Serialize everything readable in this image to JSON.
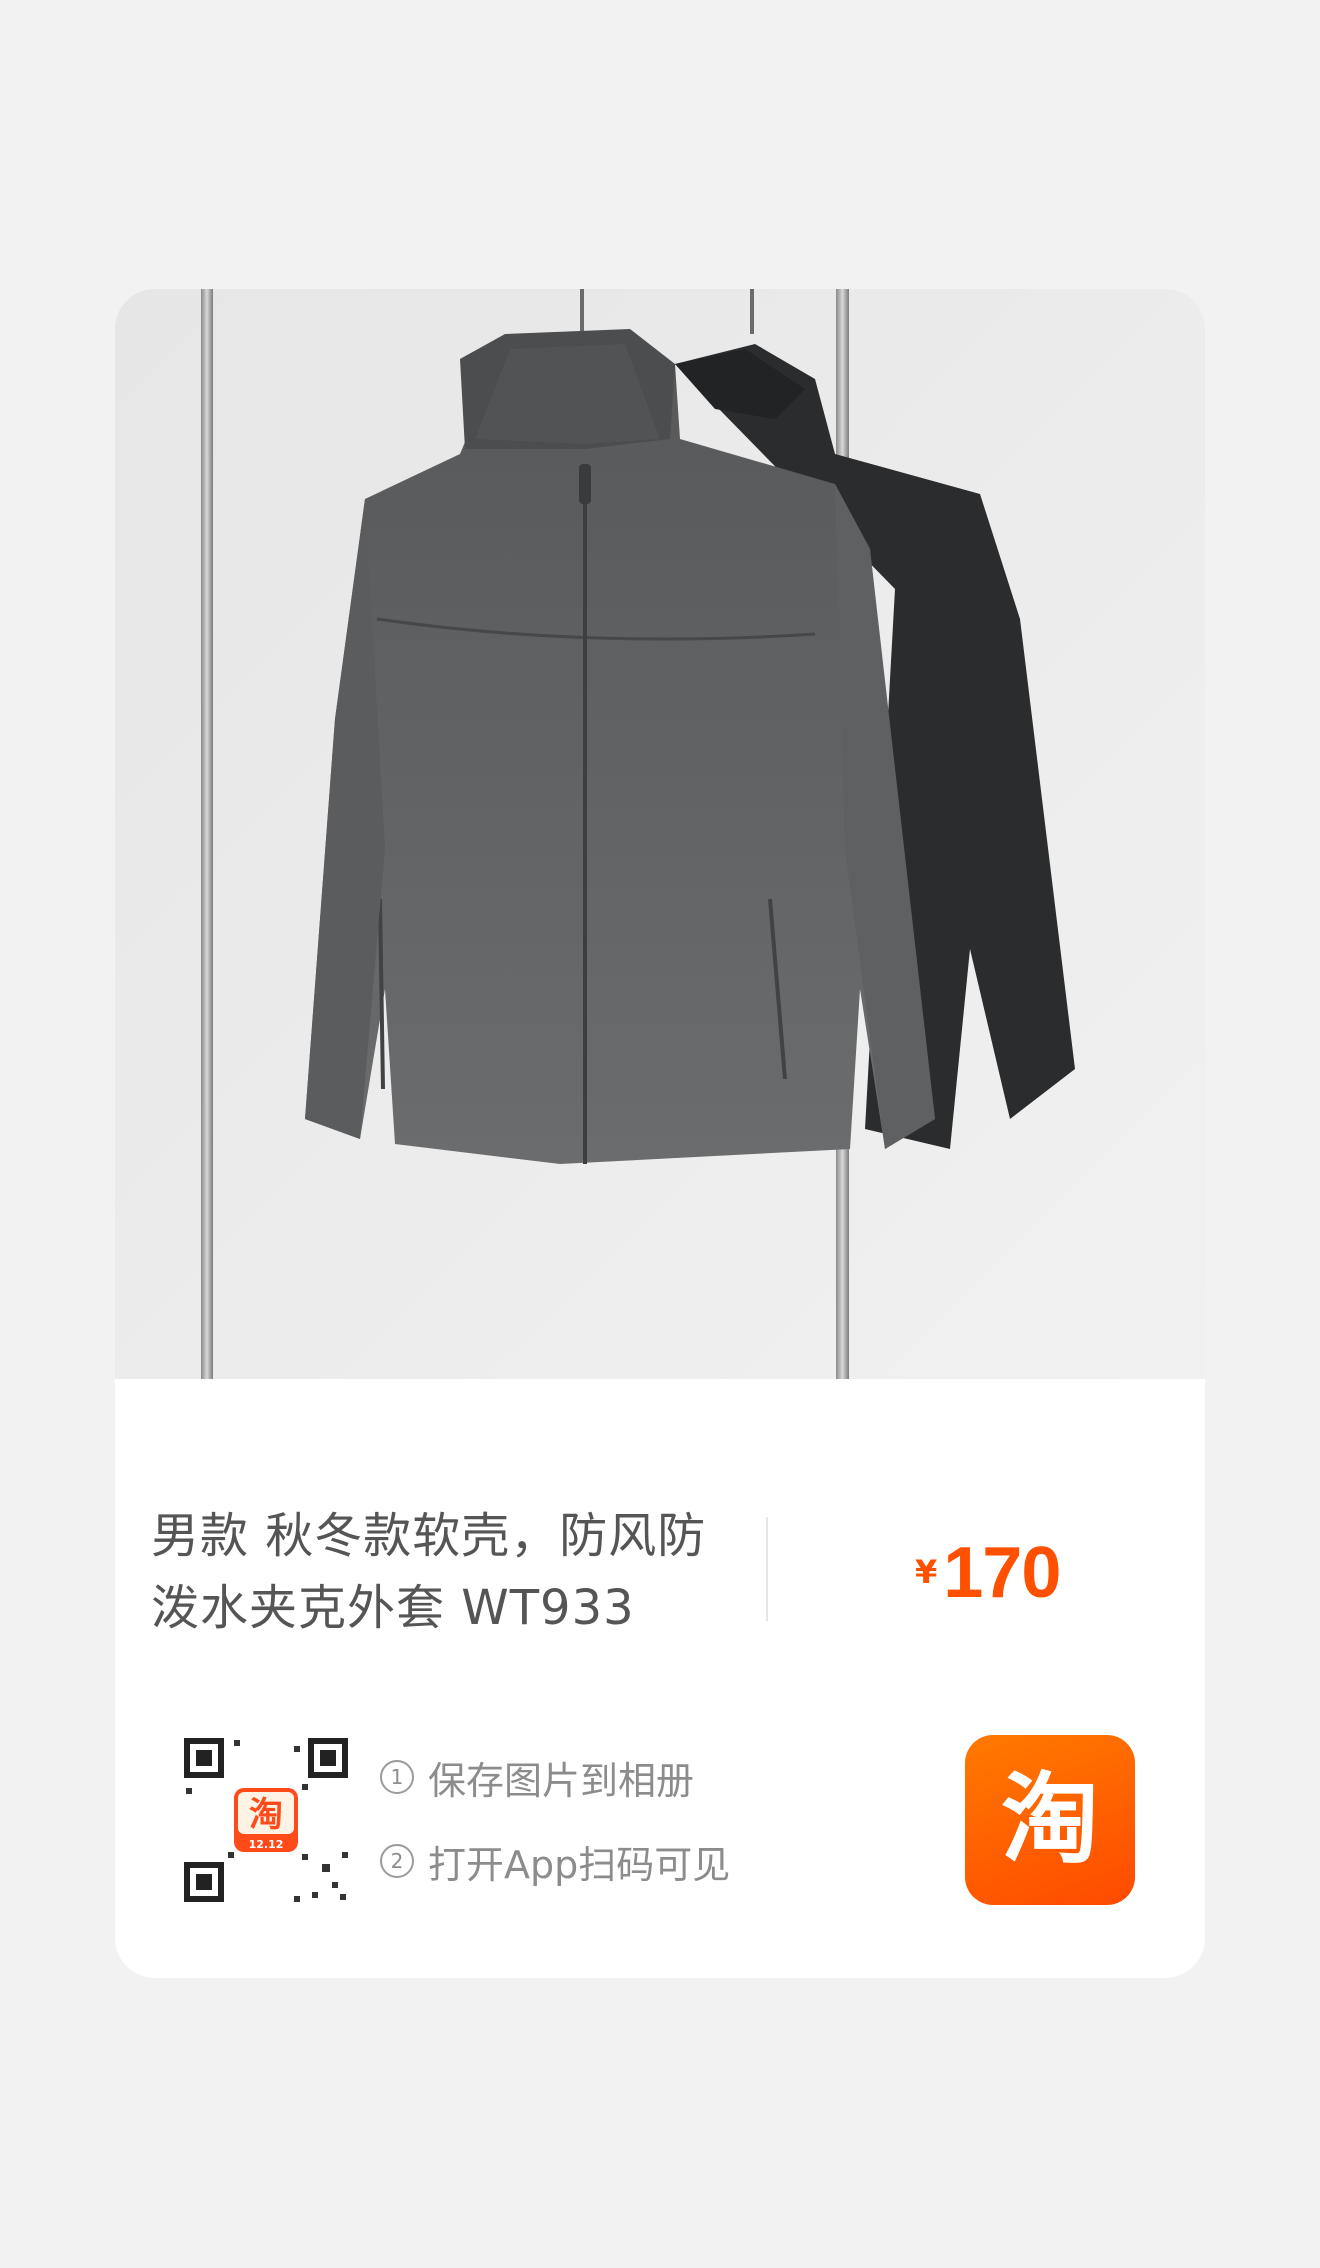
{
  "product": {
    "title": "男款 秋冬款软壳，防风防泼水夹克外套 WT933",
    "price_currency": "¥",
    "price_value": "170",
    "image_alt": "two zip-up jackets hanging on a clothing rack"
  },
  "share": {
    "steps": [
      {
        "number": "1",
        "text": "保存图片到相册"
      },
      {
        "number": "2",
        "text": "打开App扫码可见"
      }
    ],
    "qr_badge_text": "12.12"
  },
  "colors": {
    "accent": "#ff5000",
    "logo_top": "#ff7a00",
    "logo_bottom": "#ff4a00",
    "page_bg": "#f2f2f2"
  },
  "icons": {
    "qr": "qr-code-icon",
    "app_logo": "taobao-logo-icon"
  }
}
